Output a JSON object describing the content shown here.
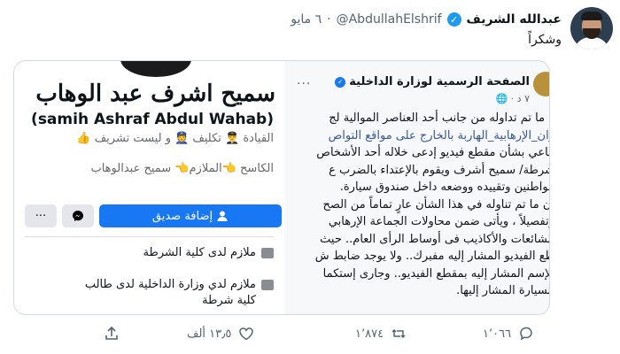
{
  "tweet": {
    "display_name": "عبدالله الشريف",
    "handle": "@AbdullahElshrif",
    "separator": "·",
    "date": "٦ مايو",
    "text": "وشكراً"
  },
  "facebook_profile": {
    "name_ar": "سميح اشرف عبد الوهاب",
    "name_en": "(samih Ashraf Abdul Wahab)",
    "line1": "القيادة 👨‍✈️ تكليف 👮 و ليست تشريف 👍",
    "line2": "الكاسح 👈الملازم👈 سميح عبدالوهاب",
    "add_friend_label": "إضافة صديق",
    "more_label": "···",
    "info": [
      "ملازم لدى كلية الشرطة",
      "ملازم لدي وزارة الداخلية لدى طالب",
      "كلية شرطة"
    ]
  },
  "ministry_post": {
    "page_name": "الصفحة الرسمية لوزارة الداخلية",
    "sub": "٧ د · 🌐",
    "more_label": "···",
    "lines": [
      "ة ما تم تداوله من جانب أحد العناصر الموالية لج",
      "وان_الإرهابية_الهاربة بالخارج على مواقع التواص",
      "ماعي بشأن مقطع فيديو إدعى خلاله أحد الأشخاص",
      "شرطة/ سميح أشرف ويقوم بالإعتداء بالضرب ع",
      "مواطنين وتقييده ووضعه داخل صندوق سيارة.",
      "أن ما تم تناوله في هذا الشأن عارٍ تماماً من الصح",
      "وتفصيلاً ، ويأتى ضمن محاولات الجماعة الإرهابي",
      "الشائعات والأكاذيب فى أوساط الرأى العام.. حيث",
      "طع الفيديو المشار إليه مفبرك.. ولا يوجد ضابط ش",
      "الإسم المشار إليه بمقطع الفيديو.. وجارى إستكما",
      "السيارة المشار إليها."
    ],
    "link_text": "وان_الإرهابية_الهاربة"
  },
  "actions": {
    "reply_count": "١٬٠٦٦",
    "retweet_count": "١٬٨٧٤",
    "like_count": "١٣٫٥ ألف",
    "share_label": ""
  }
}
